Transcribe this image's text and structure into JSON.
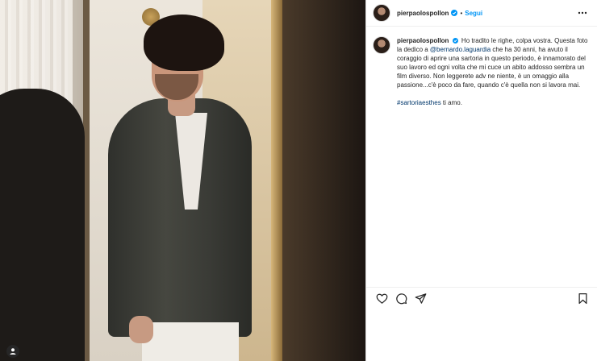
{
  "post": {
    "author": "pierpaolospollon",
    "verified": true,
    "separator": "•",
    "follow_label": "Segui",
    "icons": {
      "more": "more-options-icon",
      "like": "heart-icon",
      "comment": "comment-icon",
      "share": "paper-plane-icon",
      "save": "bookmark-icon",
      "tags": "user-tag-icon",
      "verified": "verified-badge-icon"
    },
    "colors": {
      "accent": "#0095f6",
      "link": "#00376b",
      "text": "#262626",
      "border": "#dbdbdb"
    }
  },
  "caption": {
    "username": "pierpaolospollon",
    "part1": "Ho tradito le righe, colpa vostra. Questa foto la dedico a ",
    "mention": "@bernardo.laguardia",
    "part2": " che ha 30 anni, ha avuto il coraggio di aprire una sartoria in questo periodo, è innamorato del suo lavoro ed ogni volta che mi cuce un abito addosso sembra un film diverso. Non leggerete adv ne niente, è un omaggio alla passione...c'è poco da fare, quando c'è quella non si lavora mai.",
    "hashtag": "#sartoriaesthes",
    "hashtag_suffix": " ti amo."
  }
}
